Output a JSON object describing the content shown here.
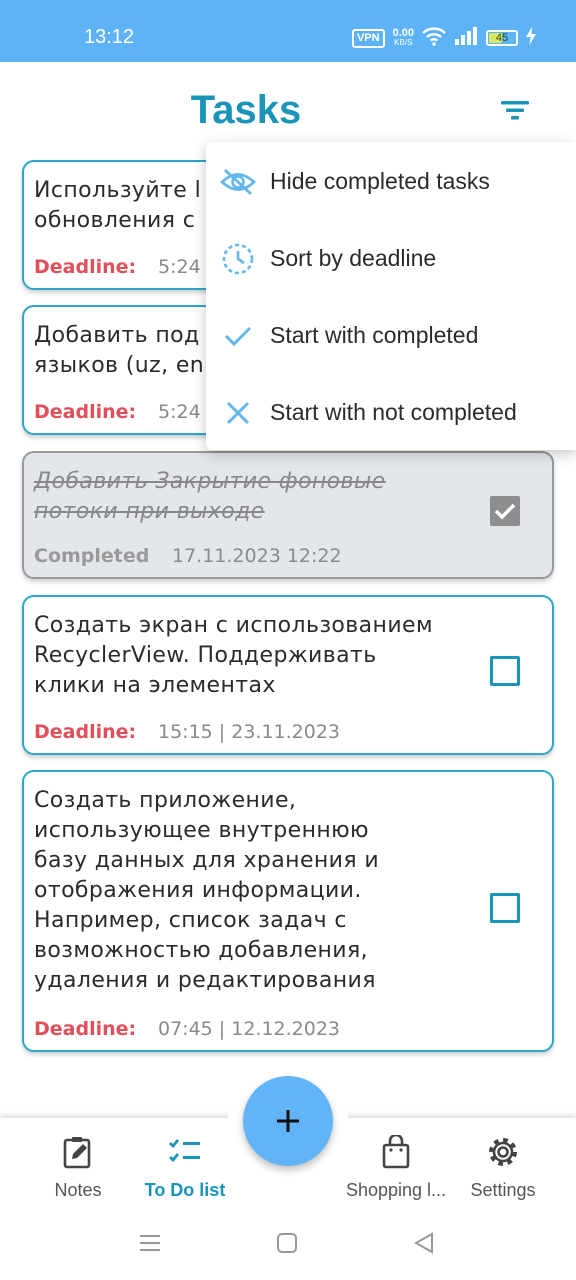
{
  "status_bar": {
    "time": "13:12",
    "vpn_label": "VPN",
    "net_speed_value": "0.00",
    "net_speed_unit": "KB/S",
    "battery_level": "45",
    "icons": [
      "wifi-icon",
      "signal-icon",
      "charging-icon"
    ]
  },
  "header": {
    "title": "Tasks",
    "filter_icon": "filter-icon"
  },
  "tasks": [
    {
      "title": "Используйте l\nобновления с",
      "status_label": "Deadline:",
      "value": "5:24",
      "completed": false
    },
    {
      "title": "Добавить под\nязыков (uz, en",
      "status_label": "Deadline:",
      "value": "5:24",
      "completed": false
    },
    {
      "title": "Добавить Закрытие фоновые\nпотоки при выходе",
      "status_label": "Completed",
      "value": "17.11.2023 12:22",
      "completed": true
    },
    {
      "title": "Создать экран с использованием\nRecyclerView. Поддерживать\nклики на элементах",
      "status_label": "Deadline:",
      "value": "15:15 | 23.11.2023",
      "completed": false
    },
    {
      "title": "Создать приложение,\nиспользующее внутреннюю\nбазу данных для хранения и\nотображения информации.\nНапример, список задач с\nвозможностью добавления,\nудаления и редактирования",
      "status_label": "Deadline:",
      "value": "07:45 | 12.12.2023",
      "completed": false
    }
  ],
  "filter_menu": {
    "items": [
      {
        "label": "Hide completed tasks",
        "icon": "eye-off-icon"
      },
      {
        "label": "Sort by deadline",
        "icon": "clock-icon"
      },
      {
        "label": "Start with completed",
        "icon": "check-icon"
      },
      {
        "label": "Start with not completed",
        "icon": "close-icon"
      }
    ]
  },
  "bottom_nav": {
    "items": [
      {
        "label": "Notes",
        "icon": "note-edit-icon",
        "active": false
      },
      {
        "label": "To Do list",
        "icon": "checklist-icon",
        "active": true
      },
      {
        "label": "Shopping l...",
        "icon": "shopping-bag-icon",
        "active": false
      },
      {
        "label": "Settings",
        "icon": "gear-icon",
        "active": false
      }
    ],
    "fab_icon": "plus-icon"
  },
  "system_nav": [
    "menu-icon",
    "home-icon",
    "back-icon"
  ],
  "colors": {
    "accent": "#1a94b8",
    "status_bar": "#5db3f5",
    "deadline": "#e0505a",
    "fab": "#61b4f6"
  }
}
